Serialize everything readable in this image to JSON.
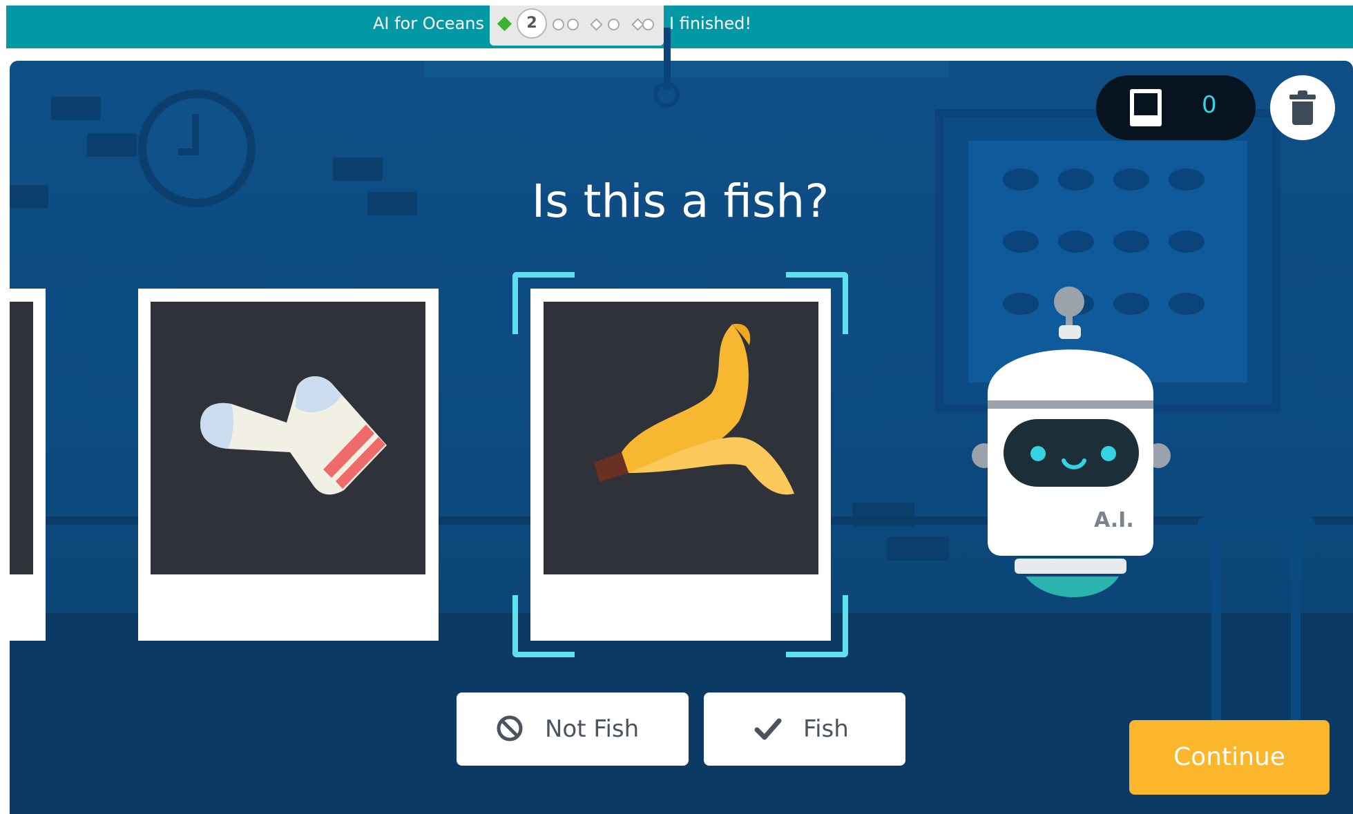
{
  "header": {
    "title": "AI for Oceans",
    "current_level": "2",
    "finished_label": "I finished!"
  },
  "counter": {
    "value": "0",
    "icon": "photo-frame-icon"
  },
  "toolbar": {
    "trash_icon": "trash-icon"
  },
  "question": "Is this a fish?",
  "cards": [
    {
      "name": "partial-previous-card"
    },
    {
      "name": "sock",
      "icon": "sock-icon"
    },
    {
      "name": "banana-peel",
      "icon": "banana-peel-icon",
      "selected": true
    }
  ],
  "robot": {
    "label": "A.I."
  },
  "buttons": {
    "not_fish_label": "Not Fish",
    "not_fish_icon": "ban-icon",
    "fish_label": "Fish",
    "fish_icon": "check-icon",
    "continue_label": "Continue"
  },
  "colors": {
    "header": "#0497a4",
    "continue": "#fbb62c",
    "selection": "#5fe0ee",
    "counter_text": "#35d3e2"
  }
}
